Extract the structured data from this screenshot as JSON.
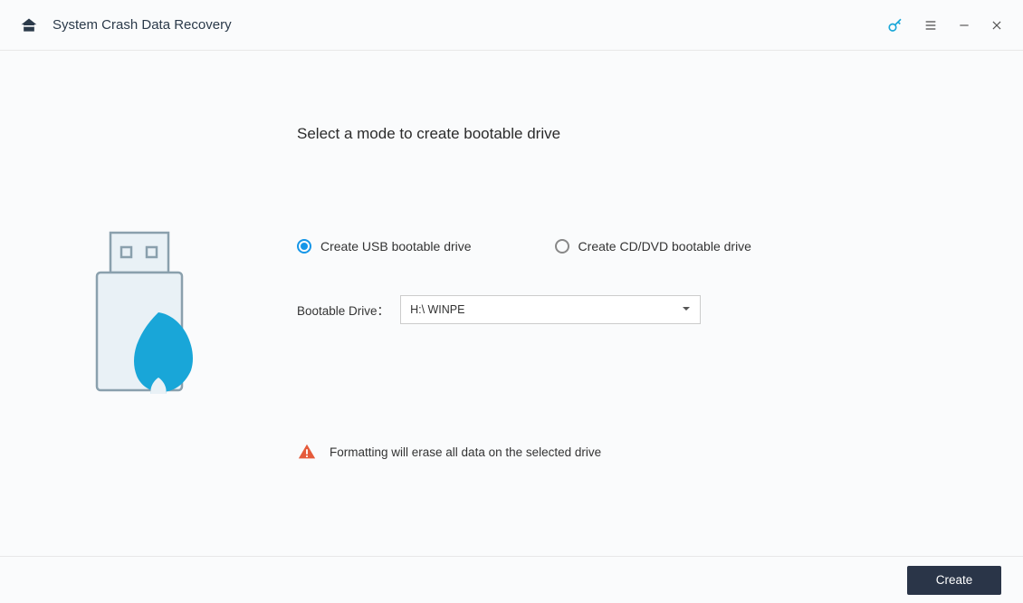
{
  "header": {
    "title": "System Crash Data Recovery"
  },
  "main": {
    "heading": "Select a mode to create bootable drive",
    "options": {
      "usb": "Create USB bootable drive",
      "cddvd": "Create CD/DVD bootable drive"
    },
    "drive_label": "Bootable Drive：",
    "drive_value": "H:\\ WINPE",
    "warning": "Formatting will erase all data on the selected drive"
  },
  "footer": {
    "create_label": "Create"
  }
}
